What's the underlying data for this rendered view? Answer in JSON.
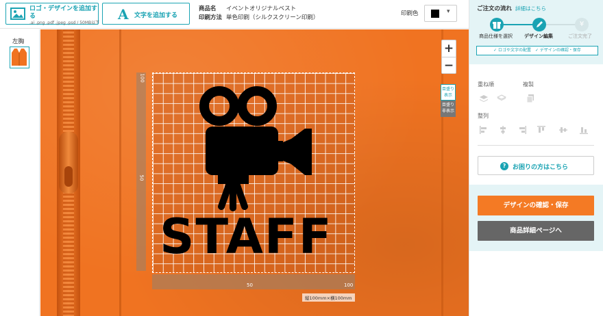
{
  "toolbar": {
    "upload_label": "ロゴ・デザインを追加する",
    "upload_formats": ".ai .png .pdf .jpeg .psd / 50MB以下",
    "add_text_label": "文字を追加する",
    "product_name_key": "商品名",
    "product_name": "イベントオリジナルベスト",
    "print_method_key": "印刷方法",
    "print_method": "単色印刷（シルクスクリーン印刷）",
    "print_color_label": "印刷色",
    "print_color_value": "#000000",
    "print_color_caret": "▾"
  },
  "placement": {
    "label": "左胸"
  },
  "canvas": {
    "design_text": "STAFF",
    "ruler_left_top": "100",
    "ruler_left_mid": "50",
    "ruler_bottom_mid": "50",
    "ruler_bottom_end": "100",
    "dimension_label": "縦100mm×横100mm",
    "zoom_in": "+",
    "zoom_out": "−",
    "grid_show": "目盛り表示",
    "grid_hide": "目盛り非表示",
    "garment_color": "#f07321"
  },
  "flow": {
    "title": "ご注文の流れ",
    "help_link": "詳細はこちら",
    "steps": [
      {
        "label": "商品仕様を選択",
        "state": "done"
      },
      {
        "label": "デザイン編集",
        "state": "current"
      },
      {
        "label": "ご注文完了",
        "state": "todo"
      }
    ],
    "substeps": "✓ ロゴや文字の配置　✓ デザインの確認・保存",
    "accent": "#1aa3b3"
  },
  "tools": {
    "layer_order": "重ね順",
    "duplicate": "複製",
    "align": "整列"
  },
  "actions": {
    "help": "お困りの方はこちら",
    "help_icon": "?",
    "save": "デザインの確認・保存",
    "detail": "商品詳細ページへ"
  }
}
